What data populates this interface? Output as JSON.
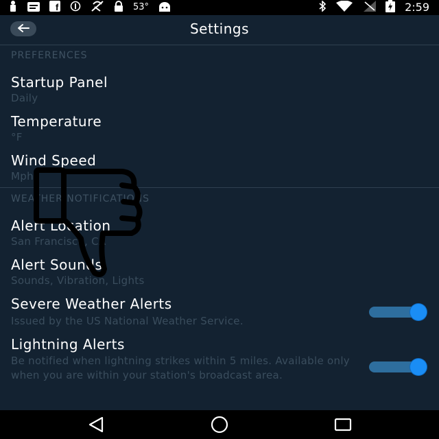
{
  "status_bar": {
    "temperature": "53°",
    "time": "2:59",
    "left_icons": [
      "figure-icon",
      "message-icon",
      "facebook-icon",
      "sync-icon",
      "no-signal-icon",
      "lock-icon",
      "temperature-text",
      "android-icon"
    ],
    "right_icons": [
      "bluetooth-icon",
      "wifi-icon",
      "no-sim-icon",
      "battery-charging-icon"
    ]
  },
  "header": {
    "title": "Settings",
    "back_icon": "arrow-left-icon"
  },
  "sections": {
    "preferences": {
      "header": "PREFERENCES",
      "items": [
        {
          "title": "Startup Panel",
          "subtitle": "Daily"
        },
        {
          "title": "Temperature",
          "subtitle": "°F"
        },
        {
          "title": "Wind Speed",
          "subtitle": "Mph"
        }
      ]
    },
    "notifications": {
      "header": "WEATHER NOTIFICATIONS",
      "items": [
        {
          "title": "Alert Location",
          "subtitle": "San Francisco, CA"
        },
        {
          "title": "Alert Sounds",
          "subtitle": "Sounds, Vibration, Lights"
        },
        {
          "title": "Severe Weather Alerts",
          "subtitle": "Issued by the US National Weather Service.",
          "enabled": true
        },
        {
          "title": "Lightning Alerts",
          "subtitle": "Be notified when lightning strikes within 5 miles. Available only when you are within your station's broadcast area.",
          "enabled": true
        }
      ]
    }
  },
  "nav_bar": {
    "buttons": [
      "back-triangle-icon",
      "home-circle-icon",
      "recents-square-icon"
    ]
  },
  "colors": {
    "background": "#132231",
    "toggle_thumb": "#1a8df5",
    "toggle_track": "#2e6e9e",
    "subtitle": "#3a4d5d"
  }
}
